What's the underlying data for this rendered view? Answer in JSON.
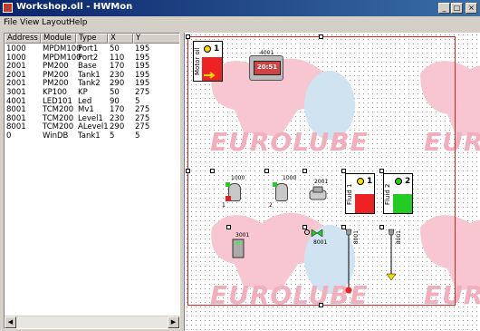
{
  "window": {
    "title": "Workshop.oll - HWMon",
    "min": "_",
    "max": "□",
    "close": "×"
  },
  "menu": [
    {
      "label": "File"
    },
    {
      "label": "View"
    },
    {
      "label": "Layout"
    },
    {
      "label": "Help"
    }
  ],
  "table": {
    "headers": [
      "Address",
      "Module",
      "Type",
      "X",
      "Y"
    ],
    "rows": [
      [
        "1000",
        "MPDM100",
        "Port1",
        "50",
        "195"
      ],
      [
        "1000",
        "MPDM100",
        "Port2",
        "110",
        "195"
      ],
      [
        "2001",
        "PM200",
        "Base",
        "170",
        "195"
      ],
      [
        "2001",
        "PM200",
        "Tank1",
        "230",
        "195"
      ],
      [
        "2001",
        "PM200",
        "Tank2",
        "290",
        "195"
      ],
      [
        "3001",
        "KP100",
        "KP",
        "50",
        "275"
      ],
      [
        "4001",
        "LED101",
        "Led",
        "90",
        "5"
      ],
      [
        "8001",
        "TCM200",
        "Mv1",
        "170",
        "275"
      ],
      [
        "8001",
        "TCM200",
        "Level1",
        "230",
        "275"
      ],
      [
        "8001",
        "TCM200",
        "ALevel1",
        "290",
        "275"
      ],
      [
        "0",
        "WinDB",
        "Tank1",
        "5",
        "5"
      ]
    ]
  },
  "canvas": {
    "brand": "EUROLUBE",
    "motor": {
      "label": "Motor oil",
      "num": "1"
    },
    "led": {
      "id": "4001",
      "display": "20:51"
    },
    "valves": [
      {
        "id": "1000",
        "port": "1"
      },
      {
        "id": "1000",
        "port": "2"
      }
    ],
    "base_id": "2001",
    "tanks": [
      {
        "label": "Fluid 1",
        "num": "1",
        "color": "#e22"
      },
      {
        "label": "Fluid 2",
        "num": "2",
        "color": "#2c2"
      }
    ],
    "keypad_id": "3001",
    "mv_id": "8001",
    "level_ids": [
      "8001",
      "8001"
    ]
  }
}
